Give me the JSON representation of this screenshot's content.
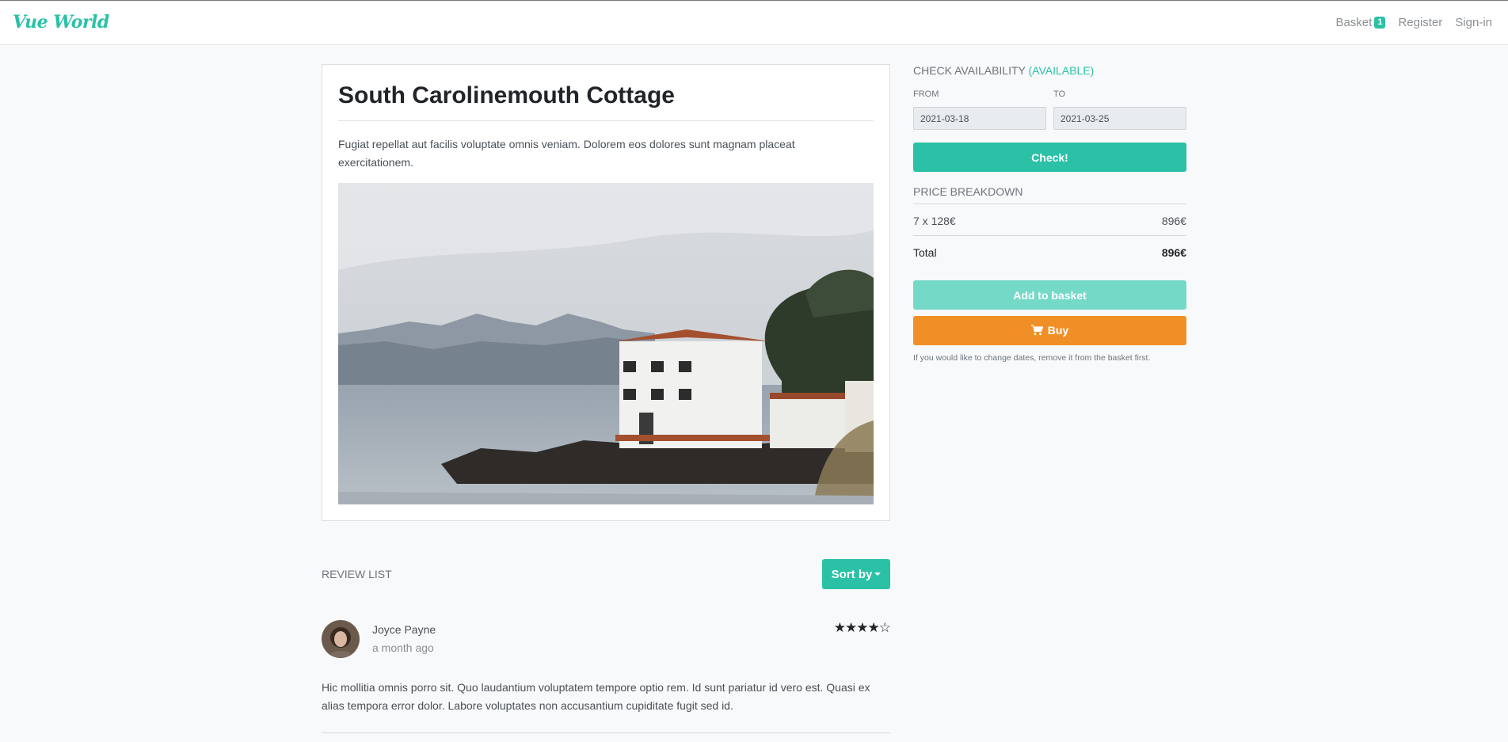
{
  "nav": {
    "brand": "Vue World",
    "basket_label": "Basket",
    "basket_count": "1",
    "register_label": "Register",
    "signin_label": "Sign-in"
  },
  "bookable": {
    "title": "South Carolinemouth Cottage",
    "description": "Fugiat repellat aut facilis voluptate omnis veniam. Dolorem eos dolores sunt magnam placeat exercitationem."
  },
  "availability": {
    "title": "CHECK AVAILABILITY",
    "status": "(AVAILABLE)",
    "from_label": "FROM",
    "to_label": "TO",
    "from_value": "2021-03-18",
    "to_value": "2021-03-25",
    "check_label": "Check!"
  },
  "price": {
    "title": "PRICE BREAKDOWN",
    "line_label": "7 x 128€",
    "line_value": "896€",
    "total_label": "Total",
    "total_value": "896€"
  },
  "actions": {
    "add_label": "Add to basket",
    "buy_label": "Buy",
    "note": "If you would like to change dates, remove it from the basket first."
  },
  "reviews": {
    "heading": "REVIEW LIST",
    "sort_label": "Sort by",
    "items": [
      {
        "author": "Joyce Payne",
        "time": "a month ago",
        "rating": 4,
        "stars": "★★★★☆",
        "text": "Hic mollitia omnis porro sit. Quo laudantium voluptatem tempore optio rem. Id sunt pariatur id vero est. Quasi ex alias tempora error dolor. Labore voluptates non accusantium cupiditate fugit sed id."
      }
    ]
  },
  "colors": {
    "accent": "#2ac1a7",
    "accent_light": "#74d9c7",
    "buy": "#f08f26"
  }
}
